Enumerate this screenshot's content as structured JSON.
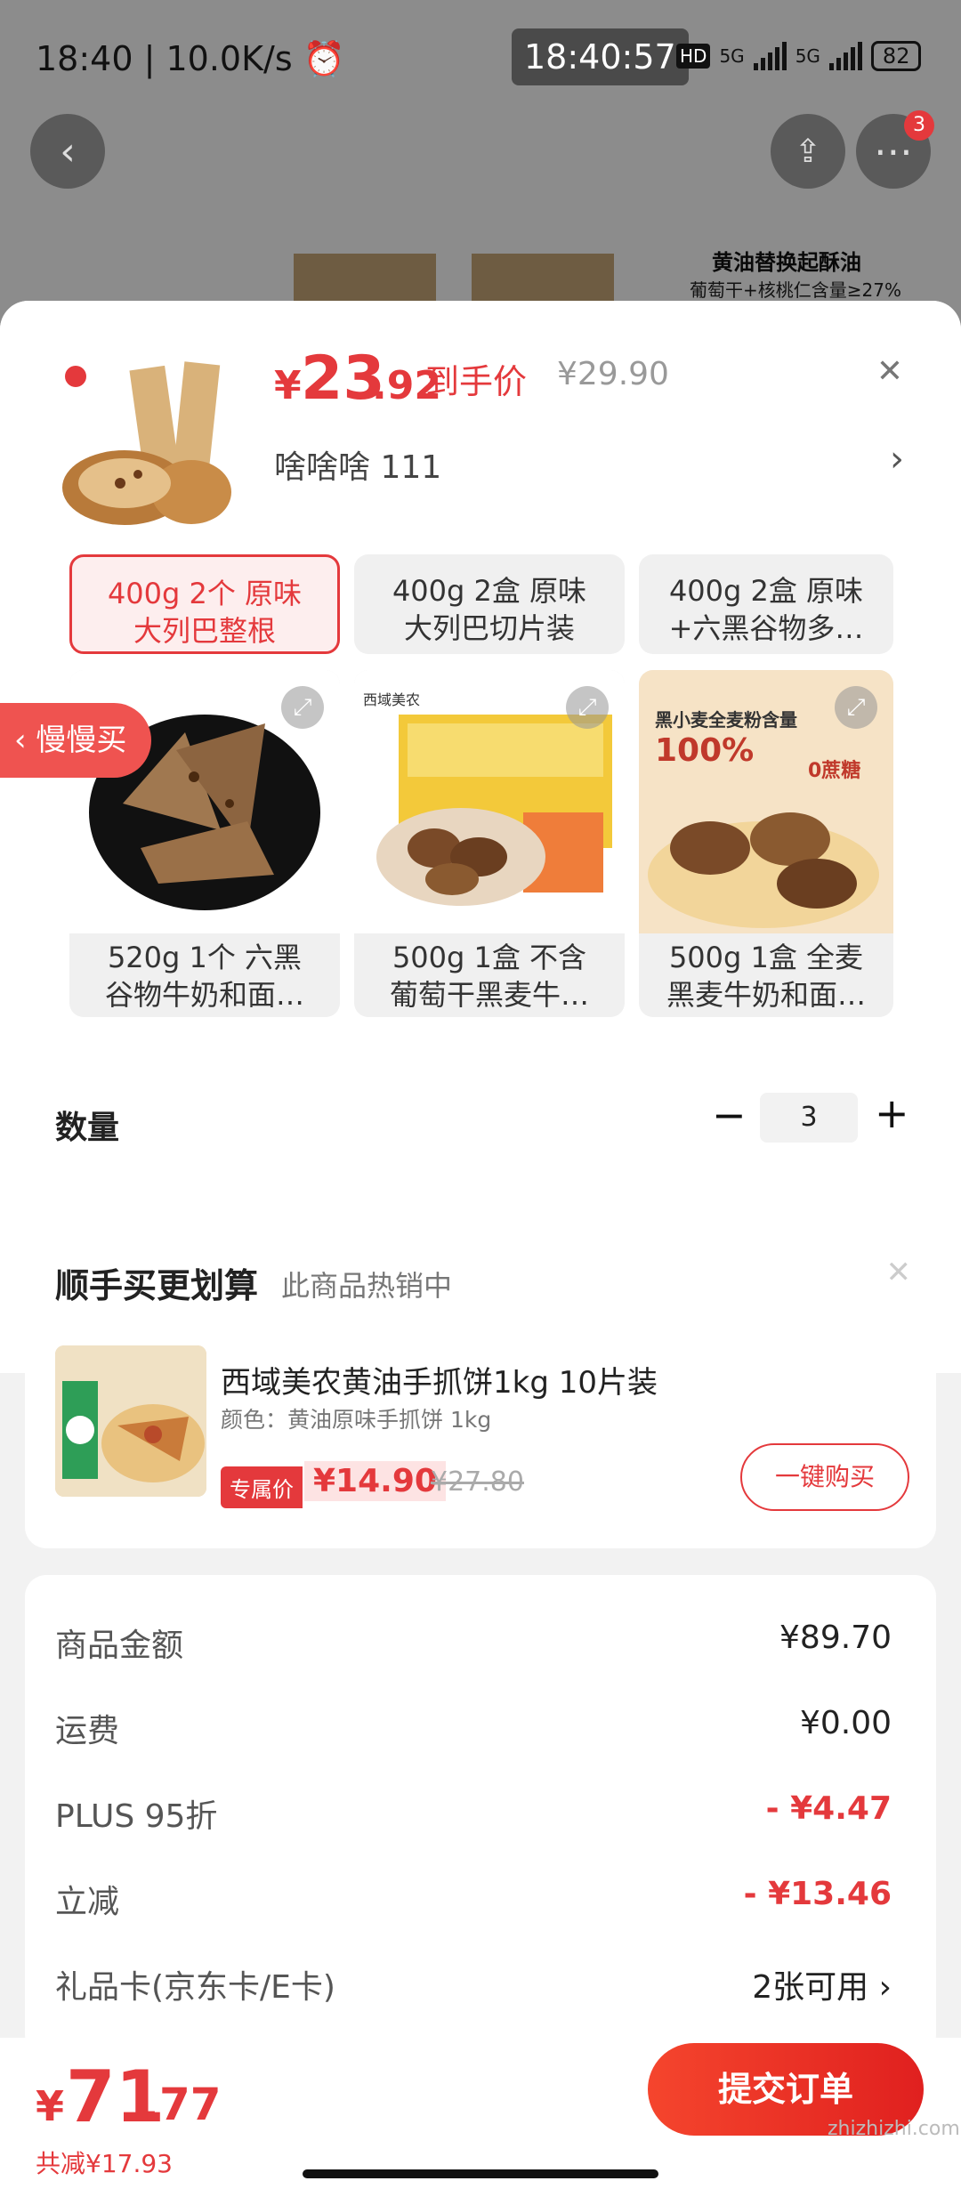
{
  "status": {
    "time": "18:40",
    "speed": "10.0K/s",
    "clock": "18:40:57",
    "hd": "HD",
    "net1": "5G",
    "net2": "5G",
    "battery": "82"
  },
  "background": {
    "badge_count": "3",
    "promo_title": "黄油替换起酥油",
    "promo_sub": "葡萄干+核桃仁含量≥27%"
  },
  "header": {
    "currency": "¥",
    "price_int": "23",
    "price_dec": ".92",
    "price_label": "到手价",
    "orig_price": "¥29.90",
    "spec": "啥啥啥  111"
  },
  "variants": [
    {
      "label1": "400g 2个 原味",
      "label2": "大列巴整根",
      "selected": true
    },
    {
      "label1": "400g 2盒 原味",
      "label2": "大列巴切片装"
    },
    {
      "label1": "400g 2盒 原味",
      "label2": "+六黑谷物多…"
    },
    {
      "label1": "520g 1个 六黑",
      "label2": "谷物牛奶和面…"
    },
    {
      "label1": "500g 1盒 不含",
      "label2": "葡萄干黑麦牛…"
    },
    {
      "label1": "500g 1盒 全麦",
      "label2": "黑麦牛奶和面…"
    }
  ],
  "variant_img_text": {
    "v5_top": "黑小麦全麦粉含量",
    "v5_pct": "100%",
    "v5_sugar": "0蔗糖",
    "brand": "西域美农"
  },
  "slow_buy": "慢慢买",
  "quantity": {
    "label": "数量",
    "value": "3"
  },
  "upsell": {
    "title": "顺手买更划算",
    "subtitle": "此商品热销中",
    "name": "西域美农黄油手抓饼1kg 10片装",
    "color": "颜色：黄油原味手抓饼 1kg",
    "tag": "专属价",
    "price": "¥14.90",
    "orig": "¥27.80",
    "button": "一键购买"
  },
  "summary": [
    {
      "k": "商品金额",
      "v": "¥89.70",
      "red": false
    },
    {
      "k": "运费",
      "v": "¥0.00",
      "red": false
    },
    {
      "k": "PLUS 95折",
      "v": "- ¥4.47",
      "red": true
    },
    {
      "k": "立减",
      "v": "- ¥13.46",
      "red": true
    },
    {
      "k": "礼品卡(京东卡/E卡)",
      "v": "2张可用 ›",
      "red": false
    }
  ],
  "bottom": {
    "currency": "¥",
    "total_int": "71",
    "total_dec": ".77",
    "saved": "共减¥17.93",
    "submit": "提交订单",
    "watermark": "zhizhizhi.com"
  },
  "colors": {
    "accent": "#e4393c",
    "background": "#f2f2f2"
  }
}
